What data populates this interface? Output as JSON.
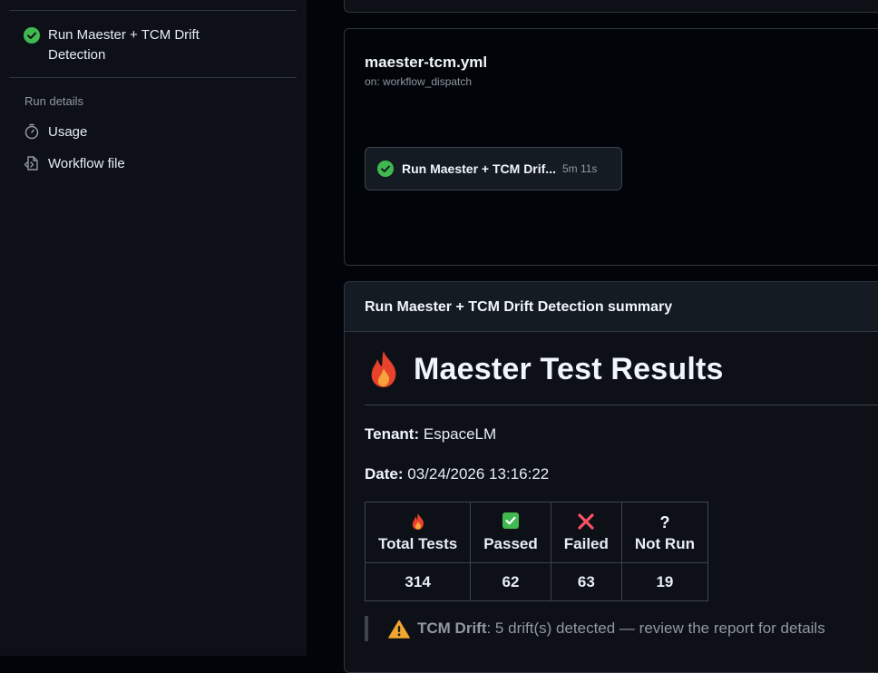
{
  "sidebar": {
    "job_label": "Run Maester + TCM Drift Detection",
    "section_title": "Run details",
    "links": [
      {
        "label": "Usage",
        "icon": "stopwatch-icon"
      },
      {
        "label": "Workflow file",
        "icon": "file-code-icon"
      }
    ]
  },
  "workflow": {
    "filename": "maester-tcm.yml",
    "trigger": "on: workflow_dispatch",
    "job": {
      "name": "Run Maester + TCM Drif...",
      "duration": "5m 11s",
      "status": "success"
    }
  },
  "summary": {
    "header": "Run Maester + TCM Drift Detection summary",
    "title": "Maester Test Results",
    "tenant_label": "Tenant:",
    "tenant_value": "EspaceLM",
    "date_label": "Date:",
    "date_value": "03/24/2026 13:16:22",
    "table": {
      "headers": [
        {
          "label": "Total Tests",
          "icon": "fire-icon"
        },
        {
          "label": "Passed",
          "icon": "check-mark-icon"
        },
        {
          "label": "Failed",
          "icon": "cross-mark-icon"
        },
        {
          "label": "Not Run",
          "icon": "question-mark-icon",
          "glyph": "?"
        }
      ],
      "values": [
        "314",
        "62",
        "63",
        "19"
      ]
    },
    "drift_label": "TCM Drift",
    "drift_text": ": 5 drift(s) detected — review the report for details"
  },
  "colors": {
    "success": "#3fb950",
    "failed": "#f85149",
    "warning": "#d29922",
    "background": "#010409",
    "sidebar": "#0d1117"
  }
}
